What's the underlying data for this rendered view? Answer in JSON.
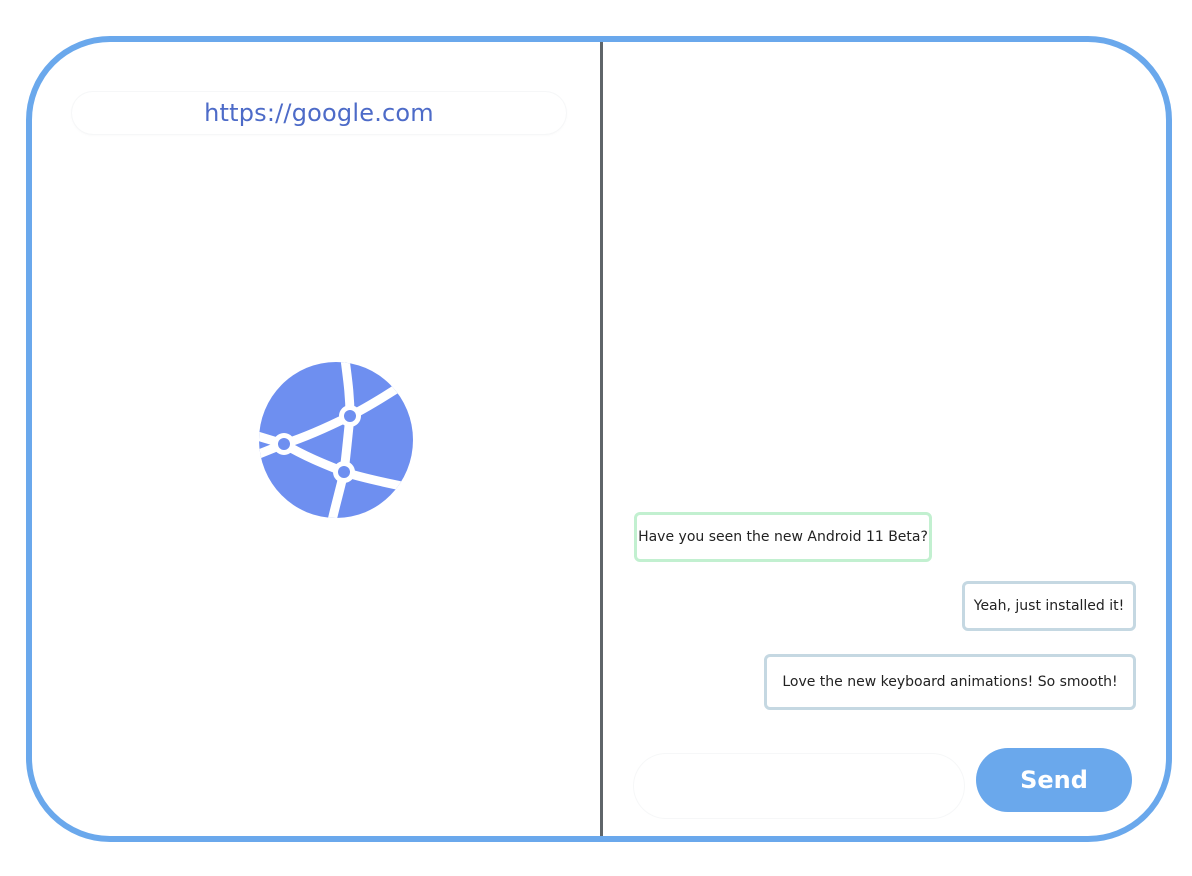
{
  "browser": {
    "url": "https://google.com",
    "loading_icon": "globe-network-icon"
  },
  "chat": {
    "messages": [
      {
        "direction": "incoming",
        "text": "Have you seen the new Android 11 Beta?"
      },
      {
        "direction": "outgoing",
        "text": "Yeah, just installed it!"
      },
      {
        "direction": "outgoing",
        "text": "Love the new keyboard animations! So smooth!"
      }
    ],
    "input_value": "",
    "send_label": "Send"
  },
  "colors": {
    "frame": "#6aa8ec",
    "globe": "#6e8ff0",
    "url_text": "#4d6bc8",
    "incoming_border": "#c2f0d0",
    "outgoing_border": "#c5d8e2",
    "send_button": "#6aa8ec",
    "divider": "#5f6569"
  }
}
